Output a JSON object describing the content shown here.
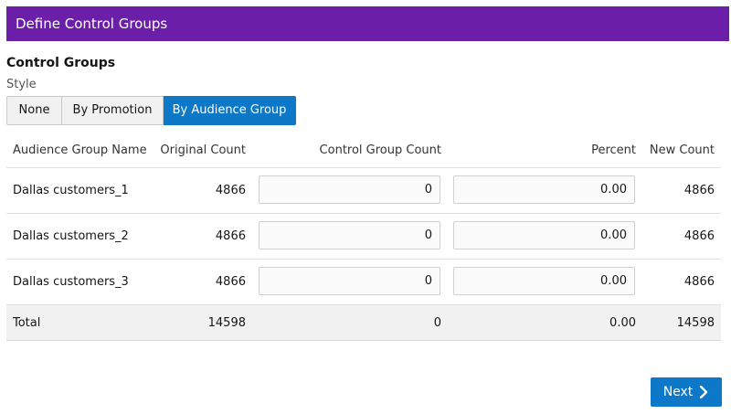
{
  "header": {
    "title": "Define Control Groups"
  },
  "section": {
    "title": "Control Groups",
    "style_label": "Style"
  },
  "style_options": [
    {
      "label": "None",
      "selected": false
    },
    {
      "label": "By Promotion",
      "selected": false
    },
    {
      "label": "By Audience Group",
      "selected": true
    }
  ],
  "table": {
    "columns": [
      "Audience Group Name",
      "Original Count",
      "Control Group Count",
      "Percent",
      "New Count"
    ],
    "rows": [
      {
        "name": "Dallas customers_1",
        "original": "4866",
        "control": "0",
        "percent": "0.00",
        "new": "4866"
      },
      {
        "name": "Dallas customers_2",
        "original": "4866",
        "control": "0",
        "percent": "0.00",
        "new": "4866"
      },
      {
        "name": "Dallas customers_3",
        "original": "4866",
        "control": "0",
        "percent": "0.00",
        "new": "4866"
      }
    ],
    "total": {
      "name": "Total",
      "original": "14598",
      "control": "0",
      "percent": "0.00",
      "new": "14598"
    }
  },
  "footer": {
    "next_label": "Next",
    "next_icon": "chevron-right-icon"
  },
  "colors": {
    "header_bg": "#6b1fa8",
    "accent": "#0c78c7"
  }
}
